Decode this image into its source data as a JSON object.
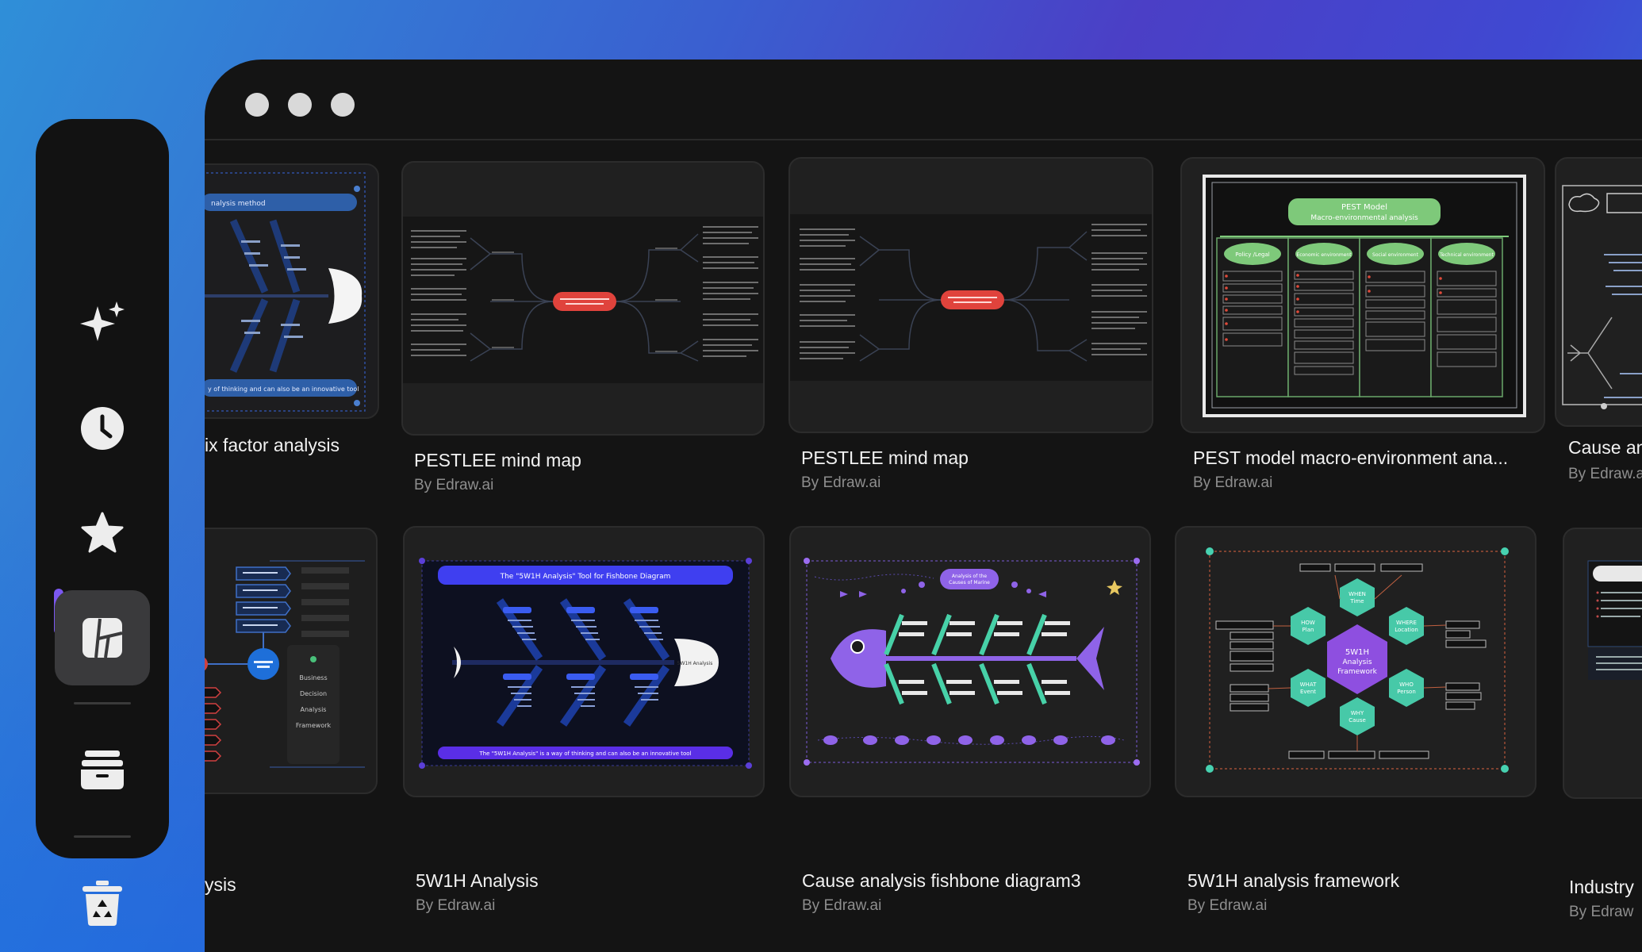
{
  "window": {
    "controls": [
      "close",
      "minimize",
      "maximize"
    ]
  },
  "sidebar": {
    "items": [
      {
        "name": "ai-sparkle",
        "icon": "sparkle-icon"
      },
      {
        "name": "recent",
        "icon": "clock-icon"
      },
      {
        "name": "favorites",
        "icon": "star-icon"
      },
      {
        "name": "templates",
        "icon": "template-icon",
        "active": true
      },
      {
        "name": "files",
        "icon": "folder-icon"
      },
      {
        "name": "trash",
        "icon": "recycle-bin-icon"
      }
    ],
    "accent": "#7b57f0"
  },
  "templates": {
    "row1": [
      {
        "title": "ix factor analysis",
        "author": "",
        "thumb_banner_top": "nalysis method",
        "thumb_banner_bottom": "y of thinking and can also be an innovative tool"
      },
      {
        "title": "PESTLEE mind map",
        "author": "By Edraw.ai"
      },
      {
        "title": "PESTLEE mind map",
        "author": "By Edraw.ai"
      },
      {
        "title": "PEST model macro-environment ana...",
        "author": "By Edraw.ai",
        "thumb_header": "PEST Model Macro-environmental analysis",
        "thumb_columns": [
          "Policy /Legal",
          "Economic environment",
          "Social environment",
          "Technical environment"
        ]
      },
      {
        "title": "Cause ana",
        "author": "By Edraw.a"
      }
    ],
    "row2": [
      {
        "title": "ysis",
        "author": "",
        "thumb_labels": [
          "Business",
          "Decision",
          "Analysis",
          "Framework"
        ]
      },
      {
        "title": "5W1H Analysis",
        "author": "By Edraw.ai",
        "thumb_banner_top": "The \"5W1H Analysis\" Tool for Fishbone Diagram",
        "thumb_banner_bottom": "The \"5W1H Analysis\" is a way of thinking and can also be an innovative tool",
        "thumb_head": "5W1H Analysis"
      },
      {
        "title": "Cause analysis fishbone diagram3",
        "author": "By Edraw.ai",
        "thumb_header": "Analysis of the Causes of Marine Pollution"
      },
      {
        "title": "5W1H analysis framework",
        "author": "By Edraw.ai",
        "thumb_center": "5W1H Analysis Framework",
        "thumb_nodes": [
          "WHEN Time",
          "WHERE Location",
          "WHO Person",
          "WHY Cause",
          "WHAT Event",
          "HOW Plan"
        ]
      },
      {
        "title": "Industry",
        "author": "By Edraw"
      }
    ]
  }
}
